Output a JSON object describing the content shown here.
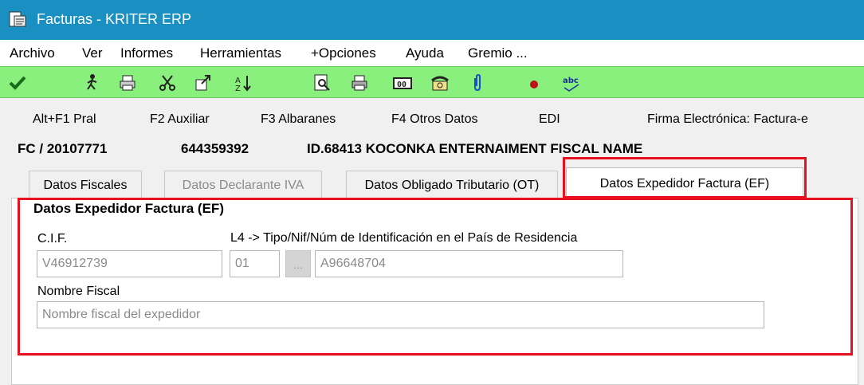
{
  "window": {
    "title": "Facturas - KRITER ERP"
  },
  "menu": [
    "Archivo",
    "Ver",
    "Informes",
    "Herramientas",
    "+Opciones",
    "Ayuda",
    "Gremio ..."
  ],
  "fkeys": [
    "Alt+F1 Pral",
    "F2 Auxiliar",
    "F3 Albaranes",
    "F4 Otros Datos",
    "EDI",
    "Firma Electrónica: Factura-e"
  ],
  "doc": {
    "number": "FC / 20107771",
    "code": "644359392",
    "client": "ID.68413 KOCONKA ENTERNAIMENT FISCAL NAME"
  },
  "tabs": [
    "Datos Fiscales",
    "Datos Declarante IVA",
    "Datos Obligado Tributario (OT)",
    "Datos Expedidor Factura (EF)"
  ],
  "group": {
    "title": "Datos Expedidor Factura (EF)",
    "cif_label": "C.I.F.",
    "cif_value": "V46912739",
    "l4_label": "L4 -> Tipo/Nif/Núm de Identificación en el País de Residencia",
    "tipo_value": "01",
    "ellipsis_label": "...",
    "id_value": "A96648704",
    "nombre_label": "Nombre Fiscal",
    "nombre_placeholder": "Nombre fiscal del expedidor"
  },
  "colors": {
    "titlebar": "#1a8fc1",
    "toolbar": "#8af07d",
    "highlight": "#e8101e"
  },
  "toolbar_icons": [
    "checkmark-icon",
    "run-icon",
    "printer-icon",
    "scissors-icon",
    "export-icon",
    "sort-icon",
    "preview-icon",
    "print-icon",
    "calculator-icon",
    "phone-icon",
    "paperclip-icon",
    "record-icon",
    "spellcheck-icon"
  ]
}
